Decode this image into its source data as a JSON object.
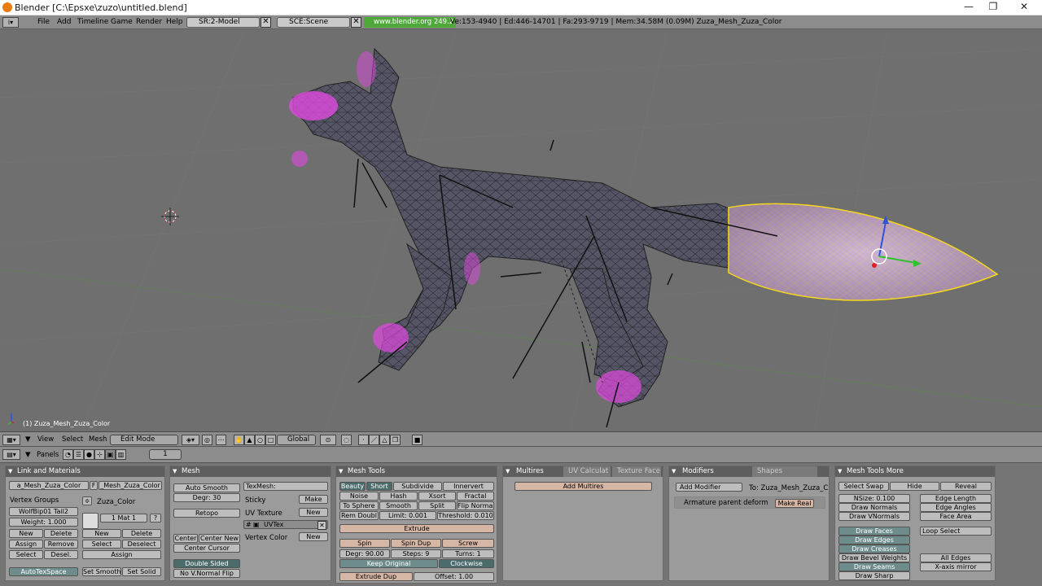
{
  "window": {
    "title": "Blender [C:\\Epsxe\\zuzo\\untitled.blend]",
    "minimize": "—",
    "maximize": "❐",
    "close": "✕"
  },
  "info": {
    "menus": [
      "File",
      "Add",
      "Timeline",
      "Game",
      "Render",
      "Help"
    ],
    "screen": "SR:2-Model",
    "scene": "SCE:Scene",
    "url": "www.blender.org 249.2",
    "stats": "Ve:153-4940 | Ed:446-14701 | Fa:293-9719 | Mem:34.58M (0.09M) Zuza_Mesh_Zuza_Color"
  },
  "viewport": {
    "object_label": "(1) Zuza_Mesh_Zuza_Color"
  },
  "view3d_header": {
    "menus": [
      "View",
      "Select",
      "Mesh"
    ],
    "mode": "Edit Mode",
    "orientation": "Global"
  },
  "panels_header": {
    "label": "Panels",
    "page": "1"
  },
  "link_materials": {
    "title": "Link and Materials",
    "mesh_name": "a_Mesh_Zuza_Color",
    "f_btn": "F",
    "ob_name": "_Mesh_Zuza_Color",
    "vertex_groups": "Vertex Groups",
    "material_name": "Zuza_Color",
    "group": "WolfBip01 Tail2",
    "weight": "Weight: 1.000",
    "mat_index": "1 Mat 1",
    "q": "?",
    "new": "New",
    "delete": "Delete",
    "assign": "Assign",
    "remove": "Remove",
    "select": "Select",
    "desel": "Desel.",
    "new2": "New",
    "delete2": "Delete",
    "select2": "Select",
    "deselect2": "Deselect",
    "assign2": "Assign",
    "autotexspace": "AutoTexSpace",
    "set_smooth": "Set Smooth",
    "set_solid": "Set Solid"
  },
  "mesh": {
    "title": "Mesh",
    "auto_smooth": "Auto Smooth",
    "degr": "Degr: 30",
    "retopo": "Retopo",
    "center": "Center",
    "center_new": "Center New",
    "center_cursor": "Center Cursor",
    "double_sided": "Double Sided",
    "no_vnormal_flip": "No V.Normal Flip",
    "texmesh": "TexMesh:",
    "sticky": "Sticky",
    "make": "Make",
    "uv_texture": "UV Texture",
    "new_uv": "New",
    "uvtex": "UVTex",
    "vertex_color": "Vertex Color",
    "new_vc": "New"
  },
  "mesh_tools": {
    "title": "Mesh Tools",
    "beauty": "Beauty",
    "short": "Short",
    "subdivide": "Subdivide",
    "innervert": "Innervert",
    "noise": "Noise",
    "hash": "Hash",
    "xsort": "Xsort",
    "fractal": "Fractal",
    "to_sphere": "To Sphere",
    "smooth": "Smooth",
    "split": "Split",
    "flip_normal": "Flip Normal",
    "rem_doubl": "Rem Doubl",
    "limit": "Limit: 0.001",
    "threshold": "Threshold: 0.010",
    "extrude": "Extrude",
    "spin": "Spin",
    "spin_dup": "Spin Dup",
    "screw": "Screw",
    "degr": "Degr: 90.00",
    "steps": "Steps: 9",
    "turns": "Turns: 1",
    "keep_original": "Keep Original",
    "clockwise": "Clockwise",
    "extrude_dup": "Extrude Dup",
    "offset": "Offset: 1.00"
  },
  "multires": {
    "tabs": [
      "Multires",
      "UV Calculat",
      "Texture Face"
    ],
    "add_multires": "Add Multires"
  },
  "modifiers": {
    "tabs": [
      "Modifiers",
      "Shapes"
    ],
    "add_modifier": "Add Modifier",
    "to": "To: Zuza_Mesh_Zuza_C",
    "armature_deform": "Armature parent deform",
    "make_real": "Make Real"
  },
  "mesh_tools_more": {
    "title": "Mesh Tools More",
    "select_swap": "Select Swap",
    "hide": "Hide",
    "reveal": "Reveal",
    "nsize": "NSize: 0.100",
    "draw_normals": "Draw Normals",
    "draw_vnormals": "Draw VNormals",
    "edge_length": "Edge Length",
    "edge_angles": "Edge Angles",
    "face_area": "Face Area",
    "draw_faces": "Draw Faces",
    "draw_edges": "Draw Edges",
    "draw_creases": "Draw Creases",
    "draw_bevel_weights": "Draw Bevel Weights",
    "draw_seams": "Draw Seams",
    "draw_sharp": "Draw Sharp",
    "loop_select": "Loop Select",
    "all_edges": "All Edges",
    "x_axis_mirror": "X-axis mirror"
  },
  "colors": {
    "viewport_bg": "#6f6f6f",
    "selected_face": "#c8a8c8",
    "selected_vert": "#ffe000",
    "seam_vert": "#ff40ff",
    "panel_title": "#5e5e5e",
    "url_green": "#4fa83a"
  }
}
